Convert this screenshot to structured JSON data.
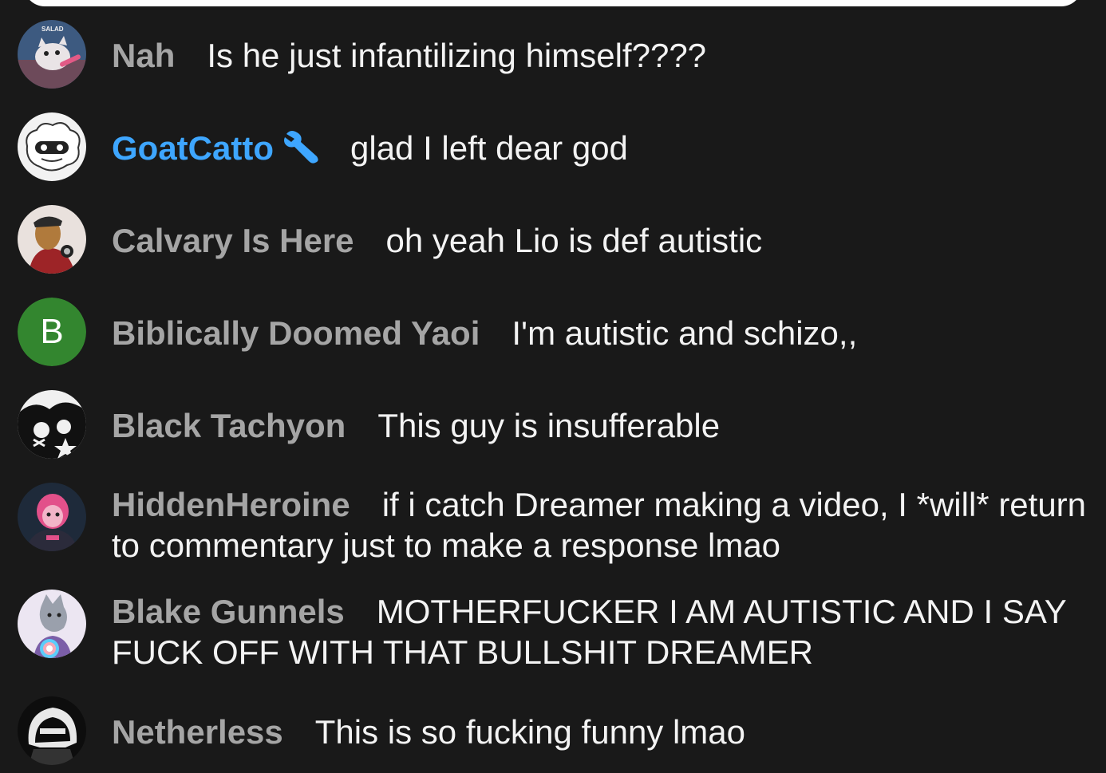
{
  "messages": [
    {
      "author": "Nah",
      "text": "Is he just infantilizing himself????",
      "avatar_icon": "kitten-photo-avatar-icon",
      "avatar_caption": "SALAD"
    },
    {
      "author": "GoatCatto",
      "text": "glad I left dear god",
      "avatar_icon": "cartoon-goat-avatar-icon",
      "badge_icon": "wrench-icon"
    },
    {
      "author": "Calvary Is Here",
      "text": "oh yeah Lio is def autistic",
      "avatar_icon": "furry-character-avatar-icon"
    },
    {
      "author": "Biblically Doomed Yaoi",
      "text": "I'm autistic and schizo,,",
      "avatar_letter": "B",
      "avatar_color": "#33862f"
    },
    {
      "author": "Black Tachyon",
      "text": "This guy is insufferable",
      "avatar_icon": "monochrome-art-avatar-icon"
    },
    {
      "author": "HiddenHeroine",
      "text": "if i catch Dreamer making a video, I *will* return to commentary just to make a response lmao",
      "avatar_icon": "pink-hair-character-avatar-icon"
    },
    {
      "author": "Blake Gunnels",
      "text": "MOTHERFUCKER I AM AUTISTIC AND I SAY FUCK OFF WITH THAT BULLSHIT DREAMER",
      "avatar_icon": "wolf-trans-flag-avatar-icon"
    },
    {
      "author": "Netherless",
      "text": "This is so fucking funny lmao",
      "avatar_icon": "hooded-figure-avatar-icon"
    }
  ],
  "colors": {
    "background": "#191919",
    "author": "#a5a5a5",
    "moderator_author": "#3ea6ff",
    "message_text": "#f3f3f3"
  }
}
